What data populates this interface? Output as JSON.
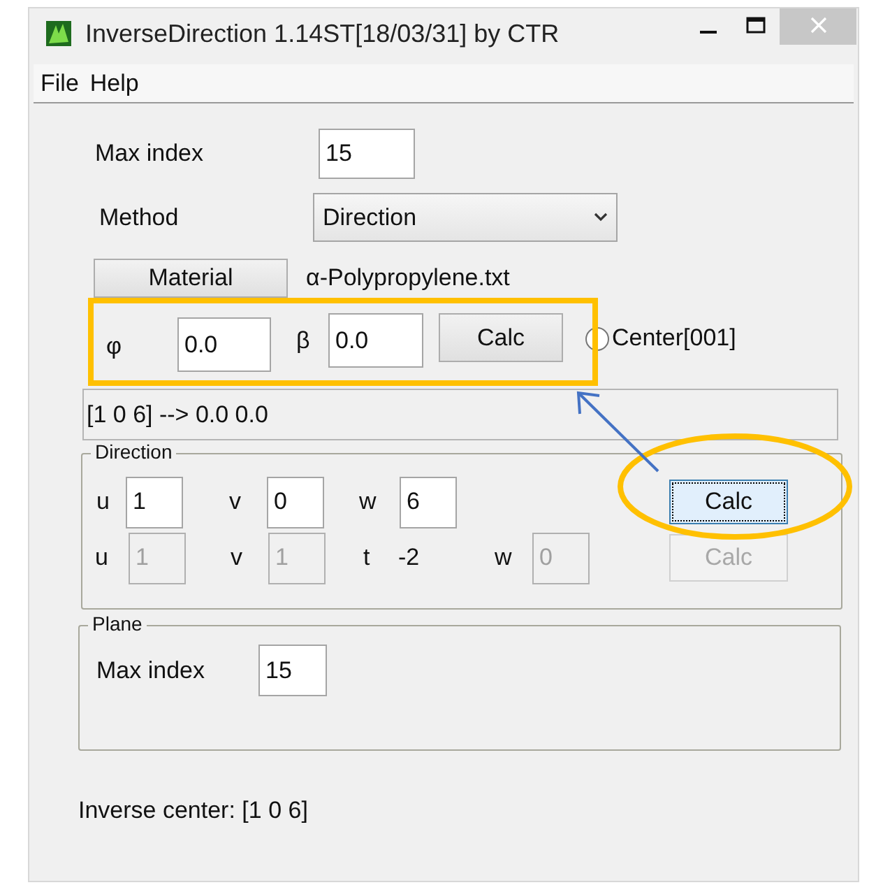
{
  "window": {
    "title": "InverseDirection 1.14ST[18/03/31] by CTR"
  },
  "menu": [
    "File",
    "Help"
  ],
  "max_index": {
    "label": "Max index",
    "value": "15"
  },
  "method": {
    "label": "Method",
    "value": "Direction"
  },
  "material": {
    "button": "Material",
    "file": "α-Polypropylene.txt"
  },
  "angles": {
    "phi_label": "φ",
    "phi": "0.0",
    "beta_label": "β",
    "beta": "0.0",
    "button": "Calc",
    "center_option": {
      "label": "Center[001]",
      "selected": false
    }
  },
  "result": "[1 0 6] --> 0.0 0.0",
  "direction": {
    "title": "Direction",
    "three_index": {
      "fields": [
        {
          "label": "u",
          "value": "1",
          "kind": "field",
          "disabled": false
        },
        {
          "label": "v",
          "value": "0",
          "kind": "field",
          "disabled": false
        },
        {
          "label": "w",
          "value": "6",
          "kind": "field",
          "disabled": false
        }
      ],
      "button": {
        "label": "Calc",
        "focused": true,
        "disabled": false
      }
    },
    "four_index": {
      "fields": [
        {
          "label": "u",
          "value": "1",
          "kind": "field",
          "disabled": true
        },
        {
          "label": "v",
          "value": "1",
          "kind": "field",
          "disabled": true
        },
        {
          "label": "t",
          "value": "-2",
          "kind": "readout"
        },
        {
          "label": "w",
          "value": "0",
          "kind": "field",
          "disabled": true
        }
      ],
      "button": {
        "label": "Calc",
        "disabled": true
      }
    }
  },
  "plane": {
    "title": "Plane",
    "max_index": {
      "label": "Max index",
      "value": "15"
    }
  },
  "status": "Inverse center: [1 0 6]"
}
